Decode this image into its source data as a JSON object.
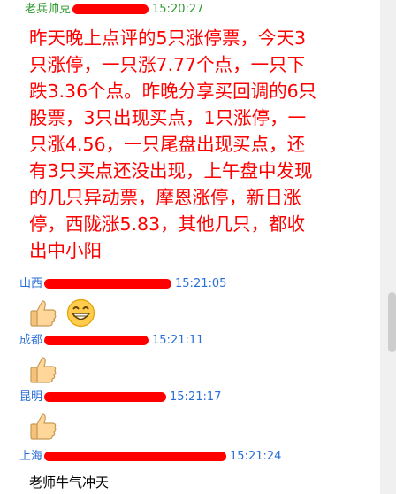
{
  "messages": [
    {
      "sender": "老兵帅克",
      "time": "15:20:27",
      "sender_color": "#2e9a2e",
      "time_color": "#2e9a2e"
    },
    {
      "sender": "山西",
      "time": "15:21:05",
      "sender_color": "#2a6fd6",
      "time_color": "#2a6fd6"
    },
    {
      "sender": "成都",
      "time": "15:21:11",
      "sender_color": "#2a6fd6",
      "time_color": "#2a6fd6"
    },
    {
      "sender": "昆明",
      "time": "15:21:17",
      "sender_color": "#2a6fd6",
      "time_color": "#2a6fd6"
    },
    {
      "sender": "上海",
      "time": "15:21:24",
      "sender_color": "#2a6fd6",
      "time_color": "#2a6fd6"
    }
  ],
  "post_lines": [
    "昨天晚上点评的5只涨停票，今天3",
    "只涨停，一只涨7.77个点，一只下",
    "跌3.36个点。昨晚分享买回调的6只",
    "股票，3只出现买点，1只涨停，一",
    "只涨4.56，一只尾盘出现买点，还",
    "有3只买点还没出现，上午盘中发现",
    "的几只异动票，摩恩涨停，新日涨",
    "停，西陇涨5.83，其他几只，都收",
    "出中小阳"
  ],
  "last_message_text": "老师牛气冲天",
  "colors": {
    "highlight": "#ff0000",
    "redaction": "#ff0000"
  },
  "icons": [
    "thumbs-up-icon",
    "grinning-face-icon"
  ]
}
